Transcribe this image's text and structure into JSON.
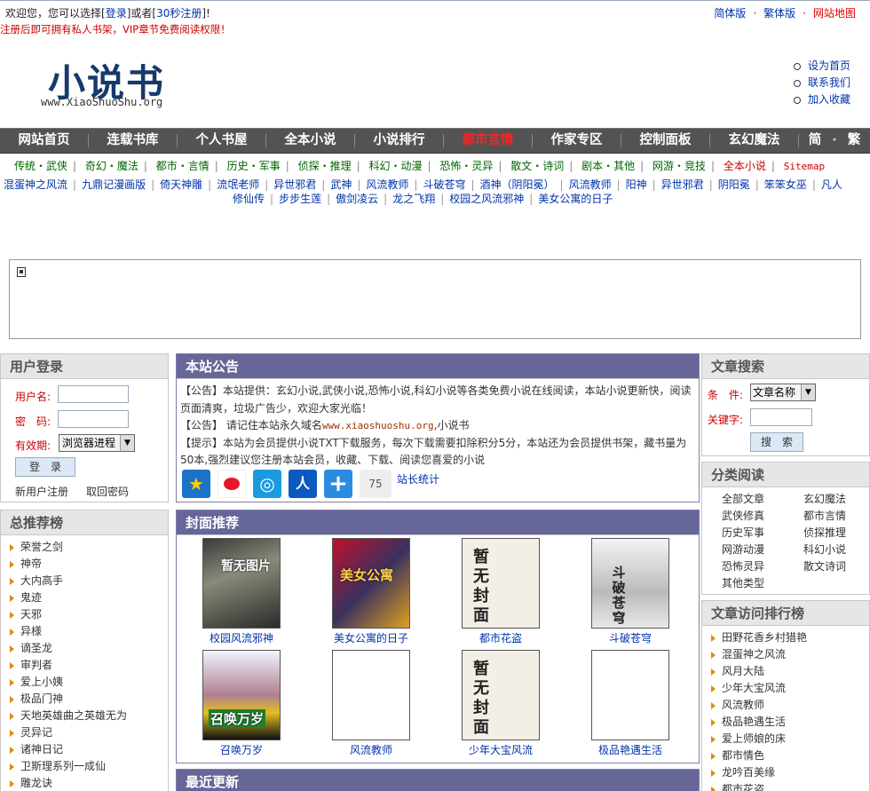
{
  "top": {
    "welcome_pre": "欢迎您，您可以选择[",
    "login": "登录",
    "welcome_mid": "]或者[",
    "register": "30秒注册",
    "welcome_post": "]!",
    "nav": [
      "简体版",
      "繁体版",
      "网站地图"
    ],
    "promo": "注册后即可拥有私人书架，VIP章节免费阅读权限！"
  },
  "logo": {
    "main": "小说书",
    "sub": "www.XiaoShuoShu.org"
  },
  "quick": [
    "设为首页",
    "联系我们",
    "加入收藏"
  ],
  "mainnav": [
    "网站首页",
    "连载书库",
    "个人书屋",
    "全本小说",
    "小说排行",
    "都市言情",
    "作家专区",
    "控制面板",
    "玄幻魔法"
  ],
  "mainnav_lang": [
    "简",
    "繁"
  ],
  "catnav": [
    "传统・武侠",
    "奇幻・魔法",
    "都市・言情",
    "历史・军事",
    "侦探・推理",
    "科幻・动漫",
    "恐怖・灵异",
    "散文・诗词",
    "剧本・其他",
    "网游・竞技",
    "全本小说",
    "Sitemap"
  ],
  "hotlinks_row1": [
    "混蛋神之风流",
    "九鼎记漫画版",
    "倚天神雕",
    "流氓老师",
    "异世邪君",
    "武神",
    "风流教师",
    "斗破苍穹",
    "酒神（阴阳冕）",
    "风流教师",
    "阳神",
    "异世邪君",
    "阴阳冕",
    "笨笨女巫",
    "凡人"
  ],
  "hotlinks_row2": [
    "修仙传",
    "步步生莲",
    "傲剑凌云",
    "龙之飞翔",
    "校园之风流邪神",
    "美女公寓的日子"
  ],
  "login_panel": {
    "title": "用户登录",
    "username": "用户名:",
    "password": "密　码:",
    "expire": "有效期:",
    "expire_value": "浏览器进程",
    "submit": "登　录",
    "new_user": "新用户注册",
    "retrieve": "取回密码"
  },
  "rank_panel": {
    "title": "总推荐榜",
    "items": [
      "荣誉之剑",
      "神帝",
      "大内高手",
      "鬼迹",
      "天邪",
      "异様",
      "谪圣龙",
      "审判者",
      "爱上小姨",
      "极品门神",
      "天地英雄曲之英雄无为",
      "灵异记",
      "诸神日记",
      "卫斯理系列一成仙",
      "雕龙诀"
    ]
  },
  "notice_panel": {
    "title": "本站公告",
    "line1": "【公告】本站提供：玄幻小说,武侠小说,恐怖小说,科幻小说等各类免费小说在线阅读，本站小说更新快，阅读页面清爽，垃圾广告少，欢迎大家光临！",
    "line2_pre": "【公告】 请记住本站永久域名",
    "line2_domain": "www.xiaoshuoshu.org",
    "line2_post": ",小说书",
    "line3": "【提示】本站为会员提供小说TXT下载服务，每次下载需要扣除积分5分，本站还为会员提供书架，藏书量为50本,强烈建议您注册本站会员，收藏、下载、阅读您喜爱的小说",
    "share_count": "75",
    "stats": "站长统计"
  },
  "covers_panel": {
    "title": "封面推荐",
    "books": [
      {
        "name": "校园风流邪神",
        "cover_text": "暂无图片"
      },
      {
        "name": "美女公寓的日子",
        "cover_text": "美女公寓"
      },
      {
        "name": "都市花盗",
        "cover_text": "暂无封面"
      },
      {
        "name": "斗破苍穹",
        "cover_text": "斗破苍穹"
      },
      {
        "name": "召唤万岁",
        "cover_text": "召唤万岁"
      },
      {
        "name": "风流教师",
        "cover_text": ""
      },
      {
        "name": "少年大宝风流",
        "cover_text": "暂无封面"
      },
      {
        "name": "极品艳遇生活",
        "cover_text": ""
      }
    ]
  },
  "recent_panel": {
    "title": "最近更新"
  },
  "search_panel": {
    "title": "文章搜索",
    "cond": "条　件:",
    "cond_value": "文章名称",
    "keyword": "关键字:",
    "submit": "搜　索"
  },
  "cats_panel": {
    "title": "分类阅读",
    "items": [
      "全部文章",
      "玄幻魔法",
      "武侠修真",
      "都市言情",
      "历史军事",
      "侦探推理",
      "网游动漫",
      "科幻小说",
      "恐怖灵异",
      "散文诗词",
      "其他类型"
    ]
  },
  "visits_panel": {
    "title": "文章访问排行榜",
    "items": [
      "田野花香乡村猎艳",
      "混蛋神之风流",
      "风月大陆",
      "少年大宝风流",
      "风流教师",
      "极品艳遇生活",
      "爱上师娘的床",
      "都市情色",
      "龙吟百美缘",
      "都市花盗"
    ]
  },
  "colors": {
    "nav_bg": "#535353",
    "panel_blue": "#666699",
    "active_red": "#ff2222"
  }
}
